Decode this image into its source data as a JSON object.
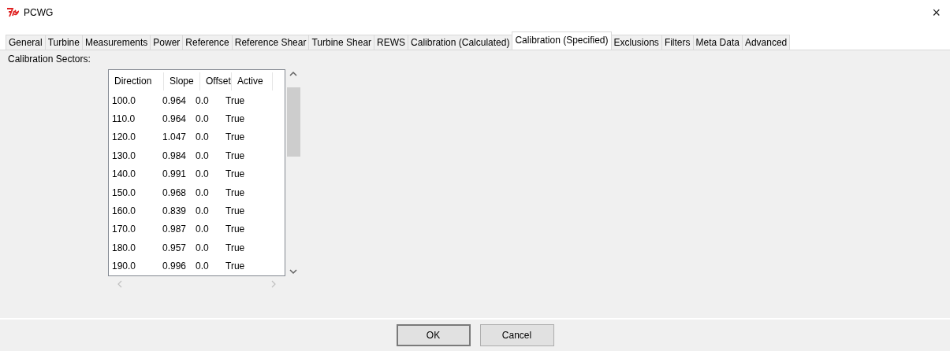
{
  "window": {
    "title": "PCWG",
    "close": "×"
  },
  "tabs": [
    {
      "label": "General",
      "selected": false
    },
    {
      "label": "Turbine",
      "selected": false
    },
    {
      "label": "Measurements",
      "selected": false
    },
    {
      "label": "Power",
      "selected": false
    },
    {
      "label": "Reference",
      "selected": false
    },
    {
      "label": "Reference Shear",
      "selected": false
    },
    {
      "label": "Turbine Shear",
      "selected": false
    },
    {
      "label": "REWS",
      "selected": false
    },
    {
      "label": "Calibration (Calculated)",
      "selected": false
    },
    {
      "label": "Calibration (Specified)",
      "selected": true
    },
    {
      "label": "Exclusions",
      "selected": false
    },
    {
      "label": "Filters",
      "selected": false
    },
    {
      "label": "Meta Data",
      "selected": false
    },
    {
      "label": "Advanced",
      "selected": false
    }
  ],
  "section_label": "Calibration Sectors:",
  "table": {
    "columns": [
      "Direction",
      "Slope",
      "Offset",
      "Active"
    ],
    "rows": [
      [
        "100.0",
        "0.964",
        "0.0",
        "True"
      ],
      [
        "110.0",
        "0.964",
        "0.0",
        "True"
      ],
      [
        "120.0",
        "1.047",
        "0.0",
        "True"
      ],
      [
        "130.0",
        "0.984",
        "0.0",
        "True"
      ],
      [
        "140.0",
        "0.991",
        "0.0",
        "True"
      ],
      [
        "150.0",
        "0.968",
        "0.0",
        "True"
      ],
      [
        "160.0",
        "0.839",
        "0.0",
        "True"
      ],
      [
        "170.0",
        "0.987",
        "0.0",
        "True"
      ],
      [
        "180.0",
        "0.957",
        "0.0",
        "True"
      ],
      [
        "190.0",
        "0.996",
        "0.0",
        "True"
      ]
    ]
  },
  "buttons": [
    {
      "label": "OK",
      "kind": "default"
    },
    {
      "label": "Cancel",
      "kind": "normal"
    }
  ]
}
